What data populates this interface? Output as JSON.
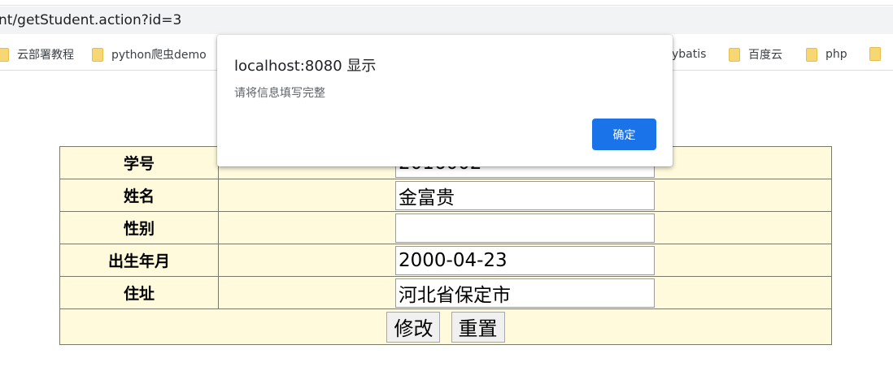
{
  "browser": {
    "url": "nt/getStudent.action?id=3",
    "bookmarks": [
      {
        "label": "云部署教程"
      },
      {
        "label": "python爬虫demo"
      },
      {
        "label": "ybatis"
      },
      {
        "label": "百度云"
      },
      {
        "label": "php"
      }
    ]
  },
  "dialog": {
    "title": "localhost:8080 显示",
    "message": "请将信息填写完整",
    "ok_label": "确定"
  },
  "form": {
    "rows": [
      {
        "label": "学号",
        "value": "2016002"
      },
      {
        "label": "姓名",
        "value": "金富贵"
      },
      {
        "label": "性别",
        "value": ""
      },
      {
        "label": "出生年月",
        "value": "2000-04-23"
      },
      {
        "label": "住址",
        "value": "河北省保定市"
      }
    ],
    "submit_label": "修改",
    "reset_label": "重置"
  }
}
